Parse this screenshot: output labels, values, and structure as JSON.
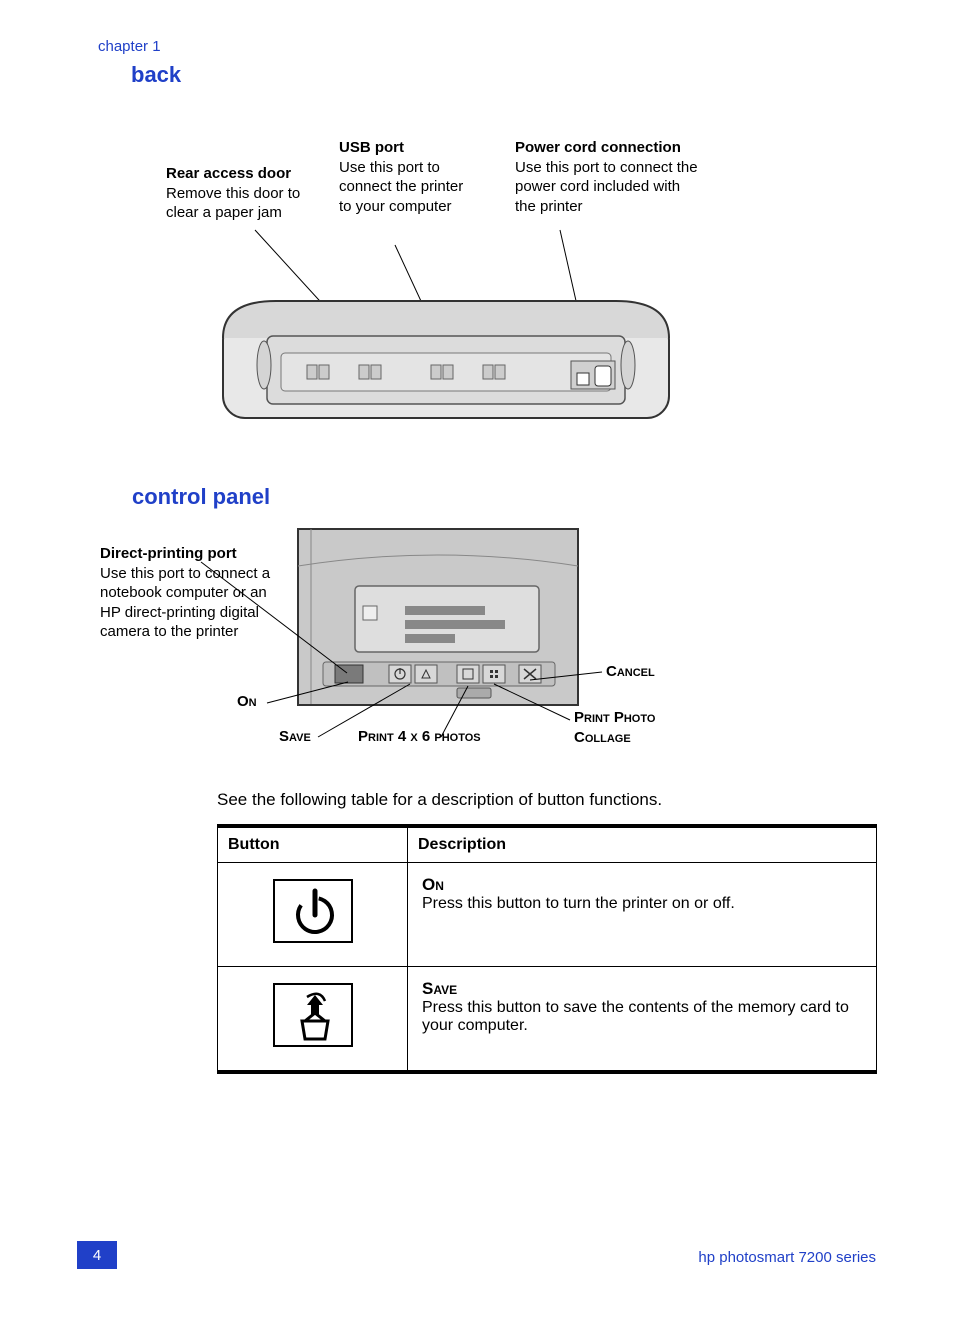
{
  "chapter": "chapter 1",
  "headings": {
    "back": "back",
    "control_panel": "control panel"
  },
  "callouts": {
    "rear": {
      "title": "Rear access door",
      "body": "Remove this door to clear a paper jam"
    },
    "usb": {
      "title": "USB port",
      "body": "Use this port to connect the printer to your computer"
    },
    "power": {
      "title": "Power cord connection",
      "body": "Use this port to connect the power cord included with the printer"
    },
    "direct": {
      "title": "Direct-printing port",
      "body": "Use this port to connect a notebook computer or an HP direct-printing digital camera to the printer"
    }
  },
  "panel_labels": {
    "on": "On",
    "save": "Save",
    "print46": "Print 4 x 6 photos",
    "print_collage": "Print Photo Collage",
    "cancel": "Cancel"
  },
  "table_intro": "See the following table for a description of button functions.",
  "table": {
    "headers": {
      "button": "Button",
      "description": "Description"
    },
    "rows": [
      {
        "name": "On",
        "desc": "Press this button to turn the printer on or off.",
        "icon": "power"
      },
      {
        "name": "Save",
        "desc": "Press this button to save the contents of the memory card to your computer.",
        "icon": "save"
      }
    ]
  },
  "footer": {
    "page": "4",
    "product": "hp photosmart 7200 series"
  }
}
